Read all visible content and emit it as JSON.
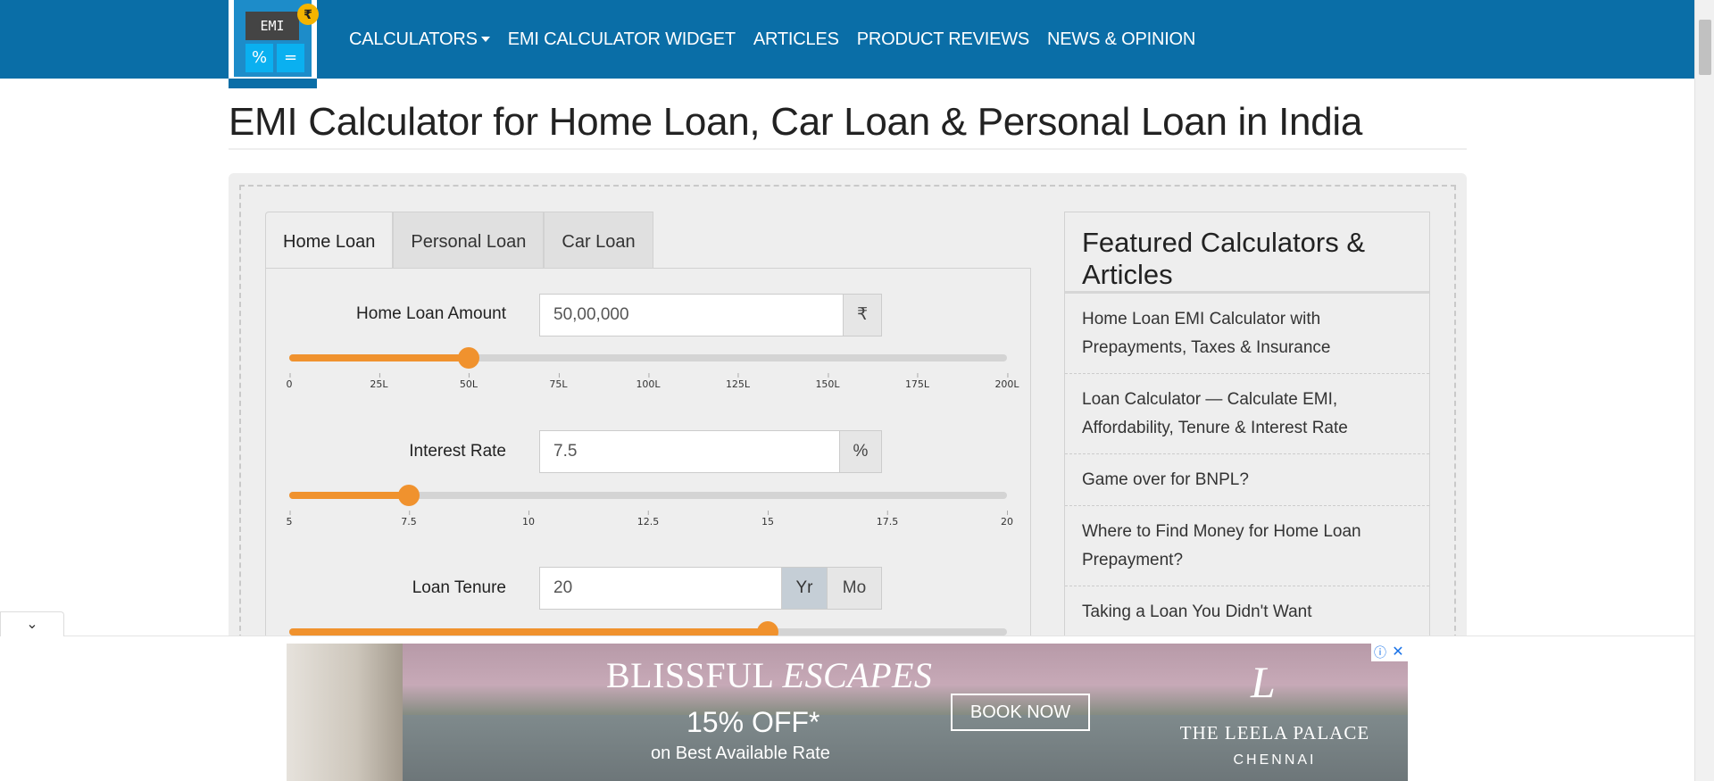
{
  "logo": {
    "screen_text": "EMI",
    "percent_key": "%",
    "equals_key": "=",
    "rupee_badge": "₹"
  },
  "nav": [
    {
      "label": "CALCULATORS",
      "has_dropdown": true
    },
    {
      "label": "EMI CALCULATOR WIDGET"
    },
    {
      "label": "ARTICLES"
    },
    {
      "label": "PRODUCT REVIEWS"
    },
    {
      "label": "NEWS & OPINION"
    }
  ],
  "page_title": "EMI Calculator for Home Loan, Car Loan & Personal Loan in India",
  "tabs": [
    {
      "label": "Home Loan",
      "active": true
    },
    {
      "label": "Personal Loan",
      "active": false
    },
    {
      "label": "Car Loan",
      "active": false
    }
  ],
  "fields": {
    "amount": {
      "label": "Home Loan Amount",
      "value": "50,00,000",
      "unit": "₹",
      "slider": {
        "min": 0,
        "max": 200,
        "value": 50,
        "ticks": [
          "0",
          "25L",
          "50L",
          "75L",
          "100L",
          "125L",
          "150L",
          "175L",
          "200L"
        ]
      }
    },
    "rate": {
      "label": "Interest Rate",
      "value": "7.5",
      "unit": "%",
      "slider": {
        "min": 5,
        "max": 20,
        "value": 7.5,
        "ticks": [
          "5",
          "7.5",
          "10",
          "12.5",
          "15",
          "17.5",
          "20"
        ]
      }
    },
    "tenure": {
      "label": "Loan Tenure",
      "value": "20",
      "unit_year": "Yr",
      "unit_month": "Mo",
      "selected_unit": "Yr",
      "slider": {
        "min": 0,
        "max": 30,
        "value": 20
      }
    }
  },
  "featured": {
    "title": "Featured Calculators & Articles",
    "items": [
      "Home Loan EMI Calculator with Prepayments, Taxes & Insurance",
      "Loan Calculator — Calculate EMI, Affordability, Tenure & Interest Rate",
      "Game over for BNPL?",
      "Where to Find Money for Home Loan Prepayment?",
      "Taking a Loan You Didn't Want"
    ]
  },
  "ad": {
    "headline_plain": "BLISSFUL",
    "headline_italic": "ESCAPES",
    "offer": "15% OFF*",
    "offer_sub": "on Best Available Rate",
    "cta": "BOOK NOW",
    "brand_mark": "L",
    "brand": "THE LEELA PALACE",
    "city": "CHENNAI",
    "info_icon": "ⓘ",
    "close_icon": "✕"
  },
  "collapse_icon": "chevron-down-icon",
  "colors": {
    "nav_bg": "#0a6ea7",
    "slider_accent": "#f0922e"
  }
}
